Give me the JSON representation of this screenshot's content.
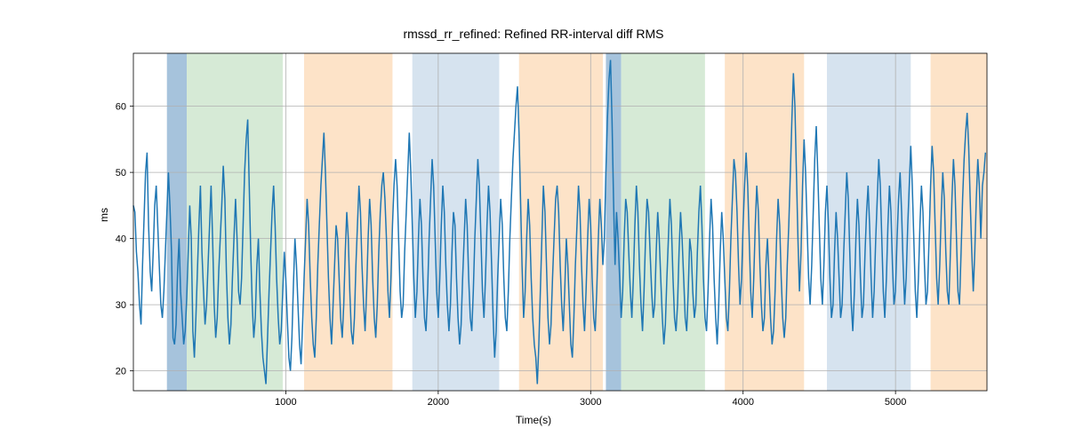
{
  "chart_data": {
    "type": "line",
    "title": "rmssd_rr_refined: Refined RR-interval diff RMS",
    "xlabel": "Time(s)",
    "ylabel": "ms",
    "xlim": [
      0,
      5600
    ],
    "ylim": [
      17,
      68
    ],
    "xticks": [
      1000,
      2000,
      3000,
      4000,
      5000
    ],
    "yticks": [
      20,
      30,
      40,
      50,
      60
    ],
    "grid": true,
    "bands": [
      {
        "start": 220,
        "end": 350,
        "color": "steelblue"
      },
      {
        "start": 350,
        "end": 980,
        "color": "green"
      },
      {
        "start": 1120,
        "end": 1700,
        "color": "orange"
      },
      {
        "start": 1830,
        "end": 2400,
        "color": "blue"
      },
      {
        "start": 2530,
        "end": 3080,
        "color": "orange"
      },
      {
        "start": 3100,
        "end": 3200,
        "color": "steelblue"
      },
      {
        "start": 3200,
        "end": 3750,
        "color": "green"
      },
      {
        "start": 3880,
        "end": 4400,
        "color": "orange"
      },
      {
        "start": 4550,
        "end": 5100,
        "color": "blue"
      },
      {
        "start": 5230,
        "end": 5600,
        "color": "orange"
      }
    ],
    "series": [
      {
        "name": "rmssd_rr_refined",
        "x_step": 10,
        "values": [
          45,
          44,
          38,
          35,
          30,
          27,
          36,
          43,
          50,
          53,
          42,
          35,
          32,
          38,
          45,
          48,
          42,
          36,
          30,
          28,
          32,
          38,
          44,
          50,
          45,
          38,
          25,
          24,
          27,
          35,
          40,
          32,
          28,
          24,
          26,
          31,
          38,
          45,
          40,
          26,
          22,
          28,
          35,
          42,
          48,
          38,
          32,
          27,
          30,
          36,
          42,
          48,
          40,
          30,
          25,
          28,
          35,
          40,
          45,
          51,
          46,
          35,
          28,
          24,
          27,
          34,
          40,
          46,
          40,
          32,
          30,
          34,
          42,
          50,
          55,
          58,
          48,
          38,
          30,
          25,
          28,
          36,
          40,
          32,
          26,
          22,
          20,
          18,
          25,
          32,
          38,
          44,
          48,
          42,
          34,
          28,
          24,
          26,
          32,
          38,
          34,
          28,
          22,
          20,
          25,
          33,
          40,
          36,
          30,
          24,
          21,
          27,
          34,
          40,
          46,
          42,
          34,
          28,
          24,
          22,
          28,
          36,
          42,
          48,
          52,
          56,
          50,
          42,
          34,
          28,
          24,
          30,
          36,
          42,
          40,
          34,
          28,
          25,
          30,
          38,
          44,
          40,
          32,
          26,
          24,
          28,
          36,
          42,
          48,
          44,
          36,
          30,
          26,
          32,
          40,
          46,
          42,
          34,
          28,
          25,
          30,
          38,
          44,
          48,
          50,
          46,
          40,
          32,
          28,
          34,
          42,
          48,
          52,
          48,
          40,
          32,
          28,
          30,
          38,
          44,
          50,
          56,
          50,
          42,
          34,
          28,
          32,
          40,
          46,
          42,
          34,
          28,
          26,
          32,
          40,
          46,
          52,
          48,
          40,
          32,
          28,
          34,
          42,
          48,
          44,
          36,
          30,
          26,
          30,
          38,
          44,
          42,
          34,
          28,
          24,
          27,
          34,
          40,
          46,
          42,
          34,
          28,
          26,
          32,
          40,
          46,
          52,
          48,
          40,
          32,
          28,
          34,
          42,
          48,
          44,
          36,
          28,
          22,
          26,
          34,
          40,
          46,
          42,
          34,
          28,
          26,
          32,
          40,
          46,
          52,
          56,
          60,
          63,
          56,
          46,
          36,
          28,
          32,
          40,
          46,
          42,
          34,
          28,
          24,
          22,
          18,
          24,
          32,
          40,
          48,
          44,
          36,
          28,
          24,
          27,
          34,
          40,
          46,
          48,
          44,
          36,
          30,
          26,
          32,
          40,
          36,
          30,
          24,
          22,
          28,
          36,
          42,
          48,
          44,
          36,
          30,
          26,
          32,
          40,
          46,
          42,
          34,
          28,
          26,
          32,
          40,
          46,
          42,
          36,
          40,
          50,
          58,
          64,
          67,
          58,
          46,
          36,
          44,
          40,
          34,
          28,
          32,
          40,
          46,
          44,
          38,
          32,
          28,
          34,
          42,
          48,
          44,
          36,
          30,
          26,
          32,
          40,
          46,
          44,
          38,
          32,
          28,
          30,
          38,
          44,
          40,
          34,
          28,
          24,
          27,
          34,
          40,
          46,
          42,
          34,
          28,
          26,
          30,
          38,
          44,
          40,
          34,
          28,
          26,
          32,
          40,
          38,
          32,
          28,
          30,
          38,
          44,
          48,
          42,
          34,
          28,
          26,
          32,
          40,
          46,
          42,
          34,
          28,
          24,
          30,
          38,
          44,
          40,
          34,
          28,
          26,
          32,
          40,
          46,
          52,
          50,
          44,
          36,
          30,
          34,
          42,
          48,
          53,
          48,
          40,
          32,
          28,
          34,
          42,
          48,
          44,
          36,
          30,
          26,
          28,
          36,
          40,
          34,
          28,
          24,
          26,
          32,
          40,
          46,
          42,
          34,
          28,
          25,
          28,
          36,
          42,
          50,
          58,
          65,
          60,
          50,
          40,
          32,
          38,
          48,
          55,
          50,
          42,
          34,
          30,
          36,
          44,
          52,
          57,
          50,
          42,
          34,
          30,
          36,
          44,
          48,
          42,
          34,
          28,
          30,
          38,
          44,
          40,
          34,
          28,
          30,
          38,
          44,
          50,
          46,
          38,
          30,
          26,
          32,
          40,
          46,
          42,
          34,
          28,
          30,
          38,
          44,
          48,
          42,
          34,
          28,
          32,
          40,
          46,
          52,
          48,
          40,
          32,
          28,
          34,
          42,
          48,
          44,
          36,
          30,
          32,
          40,
          46,
          50,
          44,
          36,
          30,
          34,
          42,
          48,
          54,
          48,
          40,
          32,
          28,
          34,
          42,
          48,
          44,
          36,
          30,
          32,
          40,
          48,
          54,
          50,
          42,
          34,
          30,
          36,
          44,
          50,
          46,
          38,
          32,
          30,
          38,
          46,
          52,
          48,
          40,
          32,
          30,
          38,
          46,
          52,
          56,
          59,
          54,
          46,
          38,
          32,
          38,
          46,
          52,
          48,
          40,
          48,
          50,
          53
        ]
      }
    ]
  }
}
